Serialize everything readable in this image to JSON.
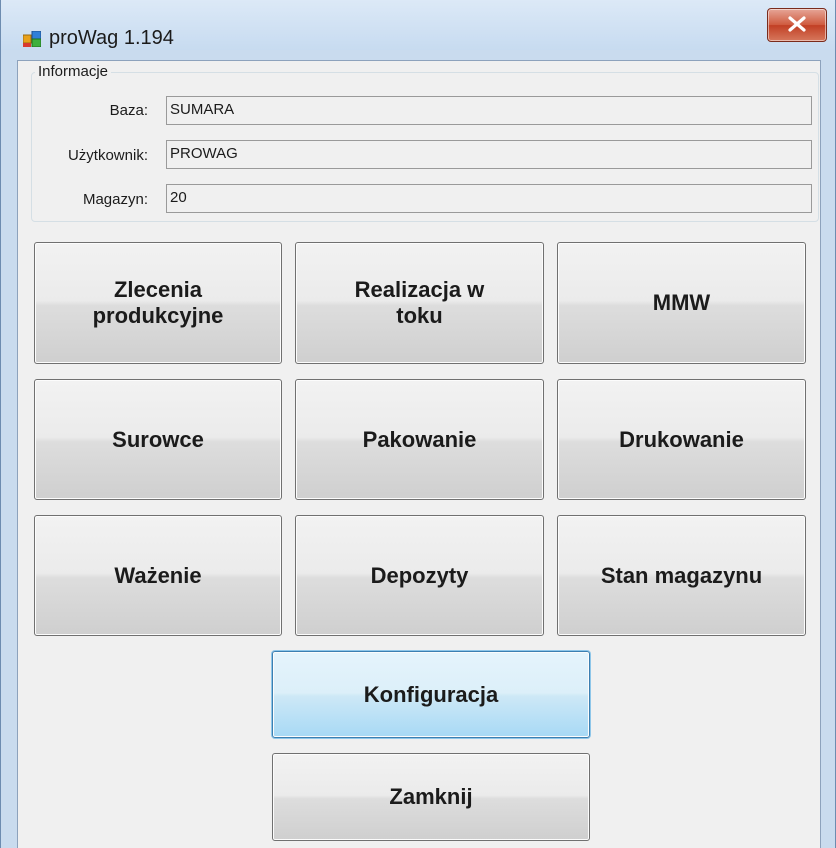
{
  "window": {
    "title": "proWag 1.194",
    "close_icon": "close-x-icon"
  },
  "info": {
    "legend": "Informacje",
    "fields": [
      {
        "label": "Baza:",
        "value": "SUMARA"
      },
      {
        "label": "Użytkownik:",
        "value": "PROWAG"
      },
      {
        "label": "Magazyn:",
        "value": "20"
      }
    ]
  },
  "buttons": {
    "zlecenia": [
      "Zlecenia",
      "produkcyjne"
    ],
    "realizacja": [
      "Realizacja w",
      "toku"
    ],
    "mmw": "MMW",
    "surowce": "Surowce",
    "pakowanie": "Pakowanie",
    "drukowanie": "Drukowanie",
    "wazenie": "Ważenie",
    "depozyty": "Depozyty",
    "stan": "Stan magazynu",
    "konfiguracja": "Konfiguracja",
    "zamknij": "Zamknij"
  },
  "colors": {
    "window_frame": "#c9dbee",
    "client_bg": "#f0f0f0",
    "focus_border": "#3c7fb1",
    "close_button": "#c13f24"
  }
}
